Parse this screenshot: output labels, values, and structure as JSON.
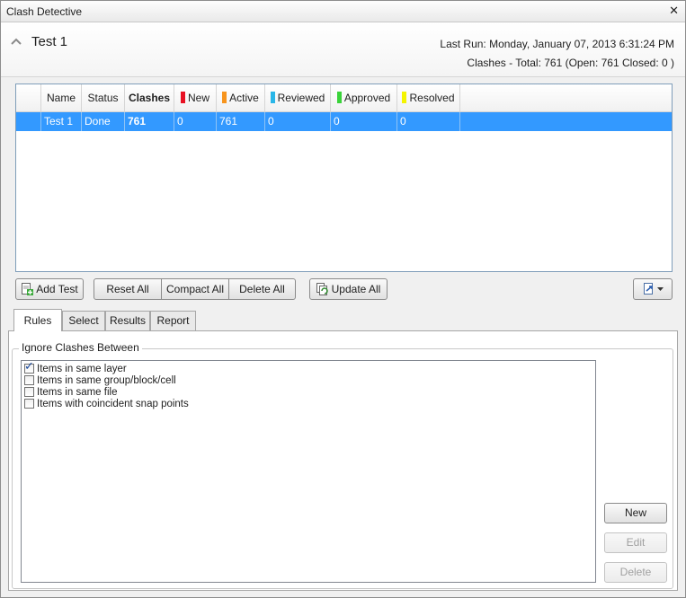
{
  "window": {
    "title": "Clash Detective",
    "close_glyph": "✕"
  },
  "header": {
    "test_name": "Test 1",
    "last_run": "Last Run:  Monday, January 07, 2013 6:31:24 PM",
    "clashes_summary": "Clashes -  Total:  761  (Open:  761  Closed:  0 )"
  },
  "grid": {
    "columns": [
      {
        "label": "",
        "swatch": null
      },
      {
        "label": "Name",
        "swatch": null
      },
      {
        "label": "Status",
        "swatch": null
      },
      {
        "label": "Clashes",
        "swatch": null,
        "bold": true
      },
      {
        "label": "New",
        "swatch": "#e81123"
      },
      {
        "label": "Active",
        "swatch": "#f7941d"
      },
      {
        "label": "Reviewed",
        "swatch": "#29b6e8"
      },
      {
        "label": "Approved",
        "swatch": "#3ad33a"
      },
      {
        "label": "Resolved",
        "swatch": "#f4f400"
      }
    ],
    "rows": [
      {
        "name": "Test 1",
        "status": "Done",
        "clashes": "761",
        "new": "0",
        "active": "761",
        "reviewed": "0",
        "approved": "0",
        "resolved": "0",
        "selected": true
      }
    ]
  },
  "toolbar": {
    "add_test": "Add Test",
    "reset_all": "Reset All",
    "compact_all": "Compact All",
    "delete_all": "Delete All",
    "update_all": "Update All",
    "export_icon": "export-icon"
  },
  "tabs": [
    "Rules",
    "Select",
    "Results",
    "Report"
  ],
  "active_tab": "Rules",
  "rules": {
    "group_label": "Ignore Clashes Between",
    "items": [
      {
        "label": "Items in same layer",
        "checked": true
      },
      {
        "label": "Items in same group/block/cell",
        "checked": false
      },
      {
        "label": "Items in same file",
        "checked": false
      },
      {
        "label": "Items with coincident snap points",
        "checked": false
      }
    ],
    "new_label": "New",
    "edit_label": "Edit",
    "delete_label": "Delete"
  }
}
